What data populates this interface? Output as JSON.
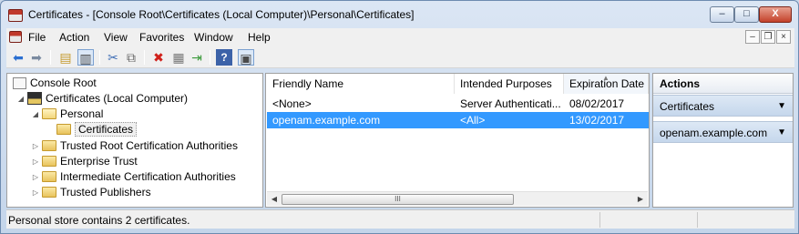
{
  "window": {
    "title": "Certificates - [Console Root\\Certificates (Local Computer)\\Personal\\Certificates]",
    "min_label": "–",
    "max_label": "□",
    "close_label": "X"
  },
  "menu": {
    "items": [
      "File",
      "Action",
      "View",
      "Favorites",
      "Window",
      "Help"
    ],
    "mdi_min": "–",
    "mdi_restore": "❐",
    "mdi_close": "×"
  },
  "toolbar": {
    "icons": [
      "back-icon",
      "forward-icon",
      "up-folder-icon",
      "show-hide-tree-icon",
      "cut-icon",
      "copy-icon",
      "delete-icon",
      "properties-icon",
      "export-icon",
      "help-icon",
      "show-action-pane-icon"
    ]
  },
  "tree": {
    "nodes": [
      {
        "label": "Console Root"
      },
      {
        "label": "Certificates (Local Computer)"
      },
      {
        "label": "Personal"
      },
      {
        "label": "Certificates"
      },
      {
        "label": "Trusted Root Certification Authorities"
      },
      {
        "label": "Enterprise Trust"
      },
      {
        "label": "Intermediate Certification Authorities"
      },
      {
        "label": "Trusted Publishers"
      }
    ]
  },
  "list": {
    "columns": [
      "Friendly Name",
      "Intended Purposes",
      "Expiration Date"
    ],
    "rows": [
      {
        "name": "<None>",
        "purposes": "Server Authenticati...",
        "expires": "08/02/2017"
      },
      {
        "name": "openam.example.com",
        "purposes": "<All>",
        "expires": "13/02/2017"
      }
    ],
    "scroll_thumb": "III"
  },
  "actions": {
    "header": "Actions",
    "sections": [
      {
        "label": "Certificates"
      },
      {
        "label": "openam.example.com"
      }
    ]
  },
  "status": {
    "text": "Personal store contains 2 certificates."
  }
}
